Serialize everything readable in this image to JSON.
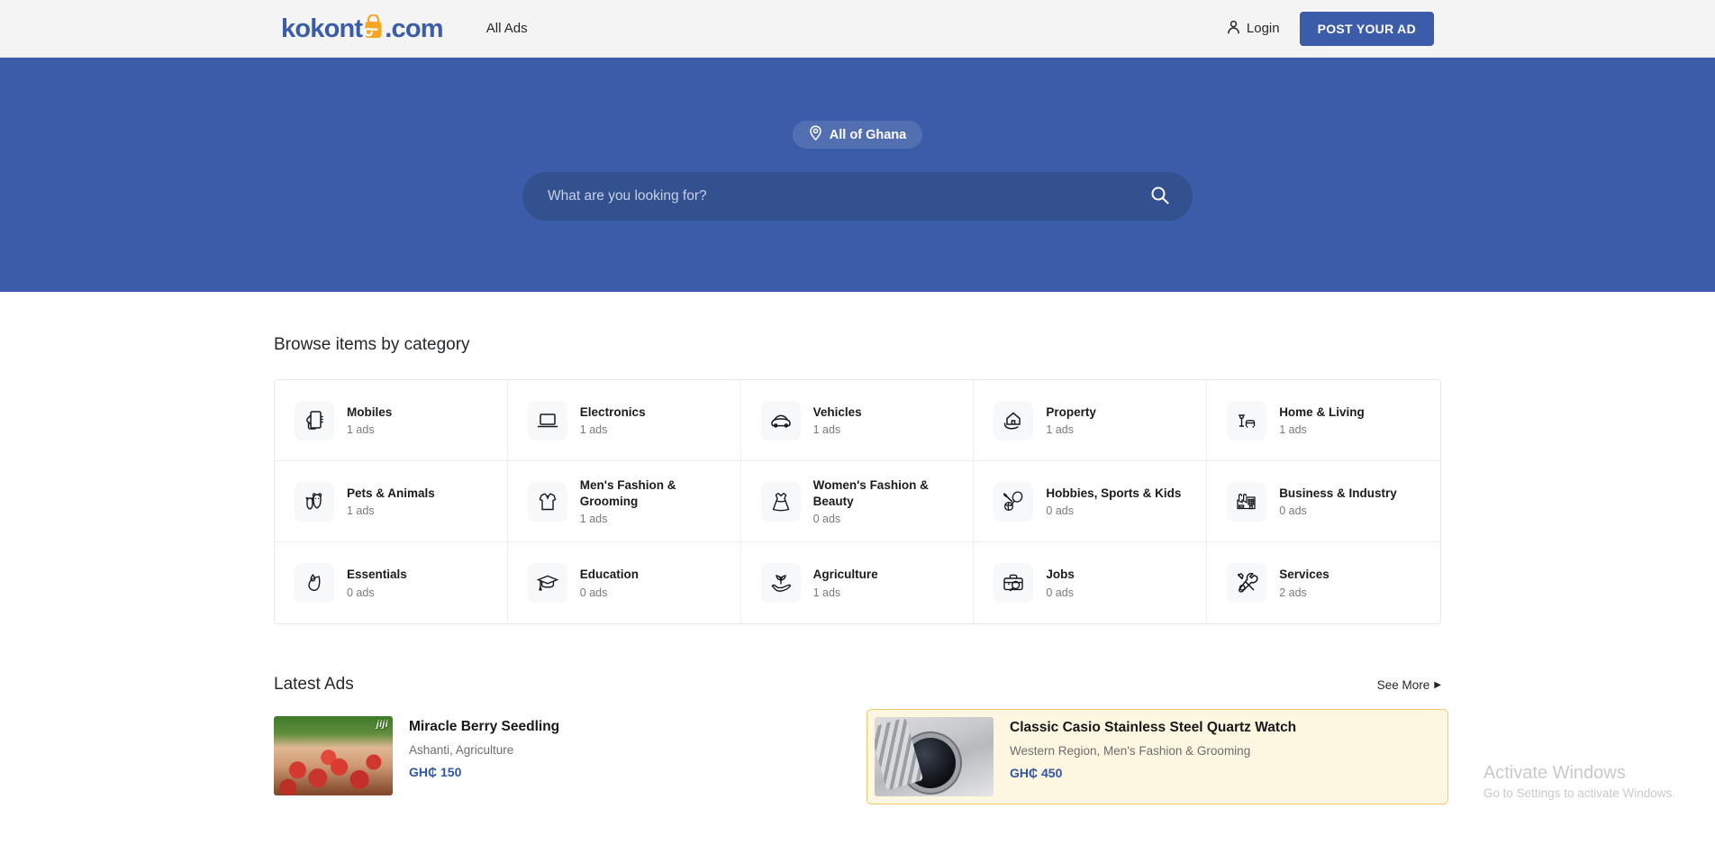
{
  "header": {
    "logo": {
      "prefix": "kokont",
      "mark_icon": "shopping-bag-e-icon",
      "suffix": ".com",
      "brand_color": "#3b5ca8",
      "accent_color": "#f5a623"
    },
    "nav": {
      "all_ads": "All Ads"
    },
    "login": {
      "label": "Login",
      "icon": "user-icon"
    },
    "post_ad_button": "POST YOUR AD"
  },
  "hero": {
    "background_color": "#3b5ca8",
    "location_pill": {
      "label": "All of Ghana",
      "icon": "location-pin-icon"
    },
    "search": {
      "placeholder": "What are you looking for?",
      "value": "",
      "icon": "search-icon"
    }
  },
  "categories": {
    "title": "Browse items by category",
    "items": [
      {
        "name": "Mobiles",
        "count": "1 ads",
        "icon": "mobile-phone-icon"
      },
      {
        "name": "Electronics",
        "count": "1 ads",
        "icon": "laptop-icon"
      },
      {
        "name": "Vehicles",
        "count": "1 ads",
        "icon": "car-icon"
      },
      {
        "name": "Property",
        "count": "1 ads",
        "icon": "house-in-hand-icon"
      },
      {
        "name": "Home & Living",
        "count": "1 ads",
        "icon": "lamp-sofa-icon"
      },
      {
        "name": "Pets & Animals",
        "count": "1 ads",
        "icon": "dog-cat-icon"
      },
      {
        "name": "Men's Fashion & Grooming",
        "count": "1 ads",
        "icon": "polo-shirt-icon"
      },
      {
        "name": "Women's Fashion & Beauty",
        "count": "0 ads",
        "icon": "dress-icon"
      },
      {
        "name": "Hobbies, Sports & Kids",
        "count": "0 ads",
        "icon": "sports-equipment-icon"
      },
      {
        "name": "Business & Industry",
        "count": "0 ads",
        "icon": "factory-icon"
      },
      {
        "name": "Essentials",
        "count": "0 ads",
        "icon": "leaf-drop-icon"
      },
      {
        "name": "Education",
        "count": "0 ads",
        "icon": "graduation-cap-icon"
      },
      {
        "name": "Agriculture",
        "count": "1 ads",
        "icon": "seedling-in-hand-icon"
      },
      {
        "name": "Jobs",
        "count": "0 ads",
        "icon": "briefcase-magnifier-icon"
      },
      {
        "name": "Services",
        "count": "2 ads",
        "icon": "wrench-screwdriver-icon"
      }
    ]
  },
  "latest_ads": {
    "title": "Latest Ads",
    "see_more": "See More",
    "see_more_caret": "▶",
    "items": [
      {
        "title": "Miracle Berry Seedling",
        "meta": "Ashanti, Agriculture",
        "price": "GH₵ 150",
        "thumb": "miracle-berry-photo",
        "thumb_watermark": "jiji",
        "promoted": false
      },
      {
        "title": "Classic Casio Stainless Steel Quartz Watch",
        "meta": "Western Region, Men's Fashion & Grooming",
        "price": "GH₵ 450",
        "thumb": "casio-watch-photo",
        "thumb_watermark": "",
        "promoted": true
      }
    ]
  },
  "watermark": {
    "title": "Activate Windows",
    "subtitle": "Go to Settings to activate Windows."
  }
}
